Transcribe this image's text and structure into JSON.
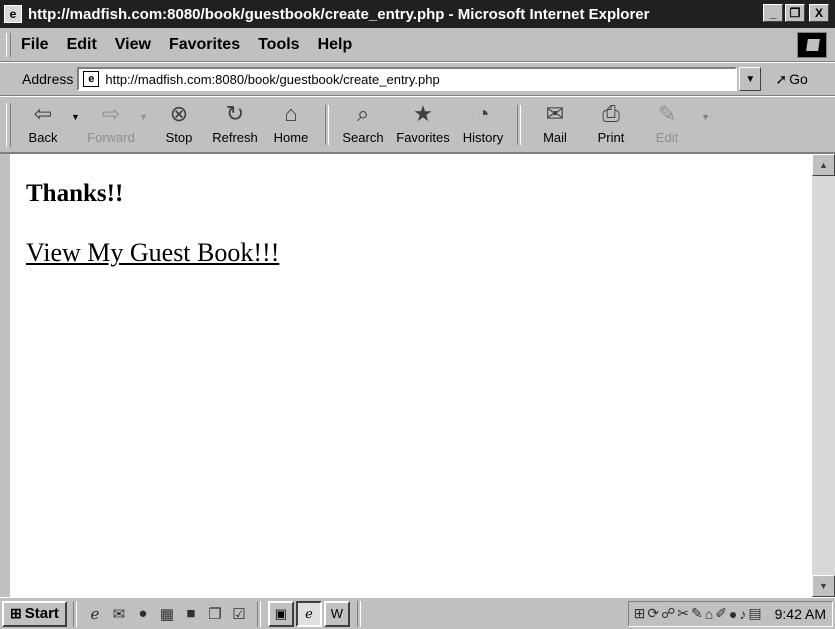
{
  "window": {
    "title": "http://madfish.com:8080/book/guestbook/create_entry.php - Microsoft Internet Explorer",
    "minimize_glyph": "_",
    "maximize_glyph": "❐",
    "close_glyph": "X"
  },
  "menu": {
    "items": [
      {
        "label": "File"
      },
      {
        "label": "Edit"
      },
      {
        "label": "View"
      },
      {
        "label": "Favorites"
      },
      {
        "label": "Tools"
      },
      {
        "label": "Help"
      }
    ]
  },
  "address": {
    "label": "Address",
    "url": "http://madfish.com:8080/book/guestbook/create_entry.php",
    "go_label": "Go"
  },
  "toolbar": {
    "buttons": [
      {
        "label": "Back",
        "icon": "back-arrow-icon",
        "glyph": "⇦",
        "enabled": true
      },
      {
        "label": "Forward",
        "icon": "forward-arrow-icon",
        "glyph": "⇨",
        "enabled": false
      },
      {
        "label": "Stop",
        "icon": "stop-icon",
        "glyph": "⊗",
        "enabled": true
      },
      {
        "label": "Refresh",
        "icon": "refresh-icon",
        "glyph": "↻",
        "enabled": true
      },
      {
        "label": "Home",
        "icon": "home-icon",
        "glyph": "⌂",
        "enabled": true
      },
      {
        "label": "Search",
        "icon": "search-icon",
        "glyph": "⌕",
        "enabled": true
      },
      {
        "label": "Favorites",
        "icon": "favorites-folder-icon",
        "glyph": "★",
        "enabled": true
      },
      {
        "label": "History",
        "icon": "history-icon",
        "glyph": "◔",
        "enabled": true
      },
      {
        "label": "Mail",
        "icon": "mail-icon",
        "glyph": "✉",
        "enabled": true
      },
      {
        "label": "Print",
        "icon": "print-icon",
        "glyph": "⎙",
        "enabled": true
      },
      {
        "label": "Edit",
        "icon": "edit-icon",
        "glyph": "✎",
        "enabled": false
      }
    ]
  },
  "page": {
    "heading": "Thanks!!",
    "link_text": "View My Guest Book!!!"
  },
  "taskbar": {
    "start_label": "Start",
    "clock": "9:42 AM"
  }
}
